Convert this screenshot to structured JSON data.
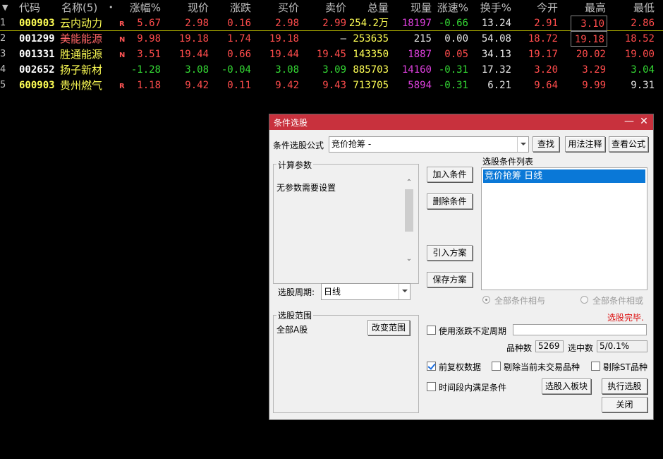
{
  "table": {
    "headers": {
      "code": "代码",
      "name": "名称(5)",
      "dot": "•",
      "change_pct": "涨幅%",
      "price": "现价",
      "change": "涨跌",
      "bid": "买价",
      "ask": "卖价",
      "volume": "总量",
      "cur_volume": "现量",
      "speed": "涨速%",
      "turnover": "换手%",
      "open": "今开",
      "high": "最高",
      "low": "最低"
    },
    "rows": [
      {
        "idx": "1",
        "code": "000903",
        "name": "云内动力",
        "flag": "R",
        "change_pct": "5.67",
        "price": "2.98",
        "change": "0.16",
        "bid": "2.98",
        "ask": "2.99",
        "volume": "254.2万",
        "cur_volume": "18197",
        "speed": "-0.66",
        "turnover": "13.24",
        "open": "2.91",
        "high": "3.10",
        "low": "2.86"
      },
      {
        "idx": "2",
        "code": "001299",
        "name": "美能能源",
        "flag": "N",
        "change_pct": "9.98",
        "price": "19.18",
        "change": "1.74",
        "bid": "19.18",
        "ask": "–",
        "volume": "253635",
        "cur_volume": "215",
        "speed": "0.00",
        "turnover": "54.08",
        "open": "18.72",
        "high": "19.18",
        "low": "18.52"
      },
      {
        "idx": "3",
        "code": "001331",
        "name": "胜通能源",
        "flag": "N",
        "change_pct": "3.51",
        "price": "19.44",
        "change": "0.66",
        "bid": "19.44",
        "ask": "19.45",
        "volume": "143350",
        "cur_volume": "1887",
        "speed": "0.05",
        "turnover": "34.13",
        "open": "19.17",
        "high": "20.02",
        "low": "19.00"
      },
      {
        "idx": "4",
        "code": "002652",
        "name": "扬子新材",
        "flag": "",
        "change_pct": "-1.28",
        "price": "3.08",
        "change": "-0.04",
        "bid": "3.08",
        "ask": "3.09",
        "volume": "885703",
        "cur_volume": "14160",
        "speed": "-0.31",
        "turnover": "17.32",
        "open": "3.20",
        "high": "3.29",
        "low": "3.04"
      },
      {
        "idx": "5",
        "code": "600903",
        "name": "贵州燃气",
        "flag": "R",
        "change_pct": "1.18",
        "price": "9.42",
        "change": "0.11",
        "bid": "9.42",
        "ask": "9.43",
        "volume": "713705",
        "cur_volume": "5894",
        "speed": "-0.31",
        "turnover": "6.21",
        "open": "9.64",
        "high": "9.99",
        "low": "9.31"
      }
    ]
  },
  "dialog": {
    "title": "条件选股",
    "minimize_glyph": "—",
    "close_glyph": "✕",
    "formula_label": "条件选股公式",
    "formula_value": "竞价抢筹  -",
    "search_button": "查找",
    "usage_button": "用法注释",
    "view_formula_button": "查看公式",
    "params_group": "计算参数",
    "params_text": "无参数需要设置",
    "period_label": "选股周期:",
    "period_value": "日线",
    "add_condition_button": "加入条件",
    "delete_condition_button": "删除条件",
    "import_plan_button": "引入方案",
    "save_plan_button": "保存方案",
    "cond_list_label": "选股条件列表",
    "cond_list_items": [
      "竞价抢筹  日线"
    ],
    "radio_and": "全部条件相与",
    "radio_or": "全部条件相或",
    "status_text": "选股完毕.",
    "scope_group": "选股范围",
    "scope_value": "全部A股",
    "change_scope_button": "改变范围",
    "use_period_label": "使用涨跌不定周期",
    "count_label": "品种数",
    "count_value": "5269",
    "selected_label": "选中数",
    "selected_value": "5/0.1%",
    "pre_adjust_label": "前复权数据",
    "exclude_untraded_label": "剔除当前未交易品种",
    "exclude_st_label": "剔除ST品种",
    "time_range_label": "时间段内满足条件",
    "to_board_button": "选股入板块",
    "execute_button": "执行选股",
    "close_button": "关闭"
  }
}
